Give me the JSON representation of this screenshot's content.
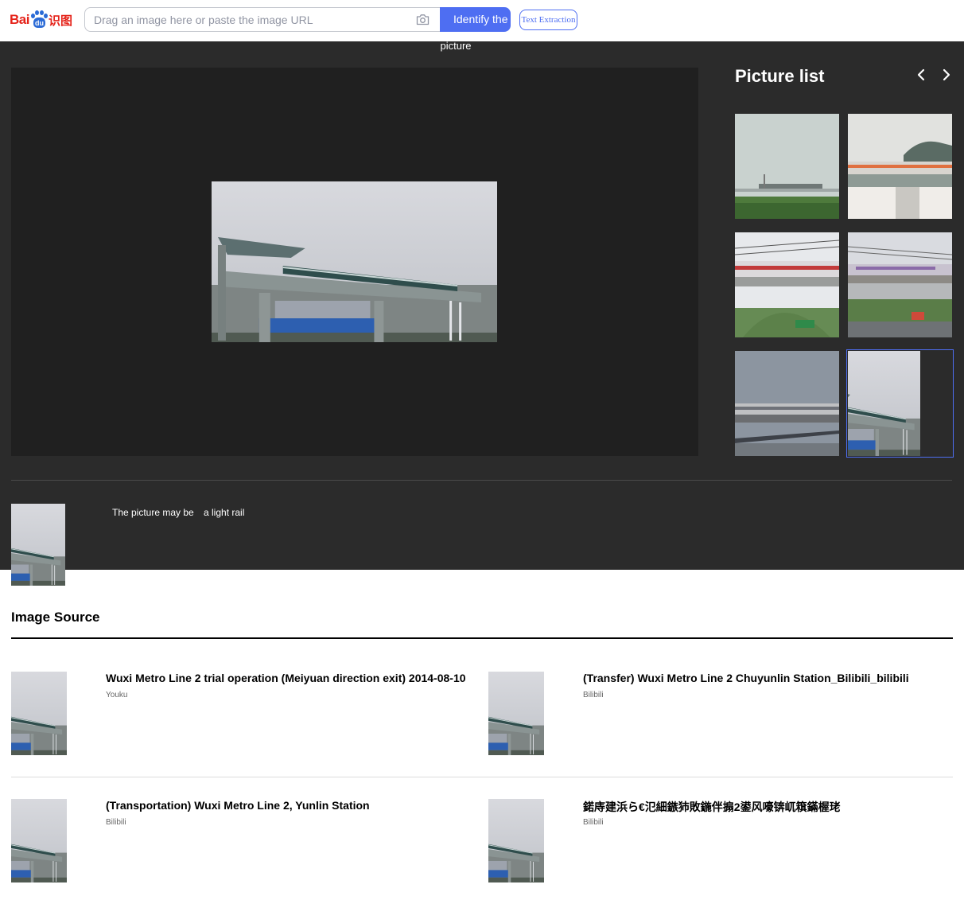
{
  "header": {
    "logo_text_left": "Bai",
    "logo_text_paw": "du",
    "logo_text_right": "识图",
    "search_placeholder": "Drag an image here or paste the image URL",
    "search_value": "",
    "identify_label": "Identify the",
    "identify_label_overflow": "picture",
    "text_extraction_label": "Text Extraction"
  },
  "viewer": {
    "picture_list_title": "Picture list",
    "thumbnails": [
      {
        "scene": "pale-sky-distant-train",
        "selected": false
      },
      {
        "scene": "curved-station-canopy",
        "selected": false
      },
      {
        "scene": "red-train-on-arch-bridge",
        "selected": false
      },
      {
        "scene": "purple-train-over-road",
        "selected": false
      },
      {
        "scene": "grey-train-on-viaduct",
        "selected": false
      },
      {
        "scene": "misty-station-platform",
        "selected": true
      }
    ],
    "result_prefix": "The picture may be",
    "result_keyword": "a light rail"
  },
  "image_source": {
    "heading": "Image Source",
    "items": [
      {
        "title": "Wuxi Metro Line 2 trial operation (Meiyuan direction exit) 2014-08-10",
        "site": "Youku"
      },
      {
        "title": "(Transfer) Wuxi Metro Line 2 Chuyunlin Station_Bilibili_bilibili",
        "site": "Bilibili"
      },
      {
        "title": "(Transportation) Wuxi Metro Line 2, Yunlin Station",
        "site": "Bilibili"
      },
      {
        "title": "鍩庤建浜ら€氾細鏃犻敗鍦伴搧2鍙风嚎锛屼簯鏋楃珯",
        "site": "Bilibili"
      }
    ]
  },
  "colors": {
    "brand_red": "#e5231a",
    "brand_blue": "#4e6ef2",
    "viewer_bg": "#2b2b2b",
    "stage_bg": "#202020"
  }
}
